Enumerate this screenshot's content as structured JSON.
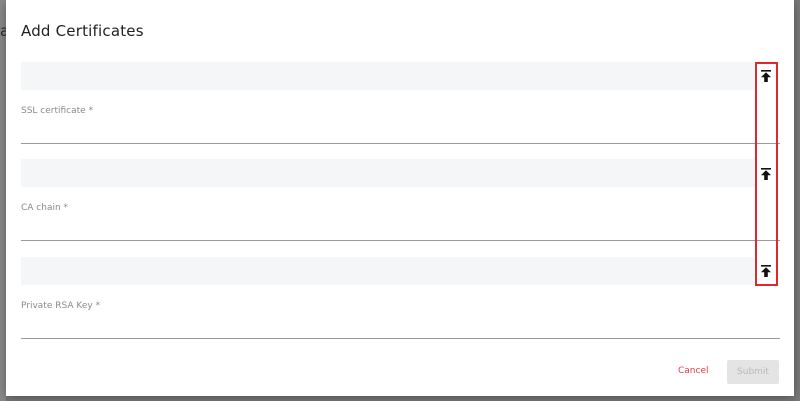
{
  "dialog": {
    "title": "Add Certificates",
    "background_peek_text": "a"
  },
  "fields": [
    {
      "label": "SSL certificate *",
      "value": "",
      "upload_icon": "upload-icon"
    },
    {
      "label": "CA chain *",
      "value": "",
      "upload_icon": "upload-icon"
    },
    {
      "label": "Private RSA Key *",
      "value": "",
      "upload_icon": "upload-icon"
    }
  ],
  "actions": {
    "cancel_label": "Cancel",
    "submit_label": "Submit",
    "submit_disabled": true
  },
  "colors": {
    "cancel": "#e23b4a",
    "highlight_box": "#e0272e",
    "submit_disabled_bg": "#e4e4e4"
  }
}
